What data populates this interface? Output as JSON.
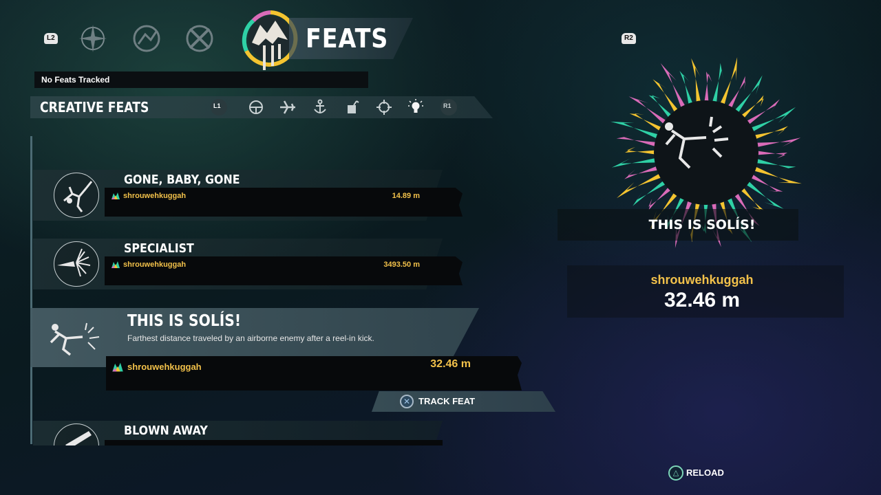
{
  "header": {
    "l2_label": "L2",
    "r2_label": "R2",
    "title": "FEATS",
    "tabs": [
      {
        "icon": "compass-icon"
      },
      {
        "icon": "wheel-icon"
      },
      {
        "icon": "crossed-weapons-icon"
      }
    ]
  },
  "tracked_text": "No Feats Tracked",
  "category": {
    "title": "CREATIVE FEATS",
    "l1_label": "L1",
    "r1_label": "R1",
    "icons": [
      "steering-wheel-icon",
      "airplane-icon",
      "anchor-icon",
      "explosive-icon",
      "crosshair-icon",
      "lightbulb-icon"
    ]
  },
  "feats": [
    {
      "name": "GONE, BABY, GONE",
      "player": "shrouwehkuggah",
      "score": "14.89 m"
    },
    {
      "name": "SPECIALIST",
      "player": "shrouwehkuggah",
      "score": "3493.50 m"
    },
    {
      "name": "BLOWN AWAY",
      "player": "",
      "score": ""
    }
  ],
  "selected": {
    "name": "THIS IS SOLÍS!",
    "description": "Farthest distance traveled by an airborne enemy after a reel-in kick.",
    "player": "shrouwehkuggah",
    "score": "32.46 m",
    "track_label": "TRACK FEAT",
    "track_button": "✕"
  },
  "detail": {
    "name": "THIS IS SOLÍS!",
    "player": "shrouwehkuggah",
    "score": "32.46 m"
  },
  "footer": {
    "reload_label": "RELOAD",
    "reload_button": "△"
  },
  "colors": {
    "accent_yellow": "#f2c14a",
    "burst_pink": "#d96bb8",
    "burst_teal": "#2fd1a6",
    "burst_yellow": "#f4c430"
  }
}
